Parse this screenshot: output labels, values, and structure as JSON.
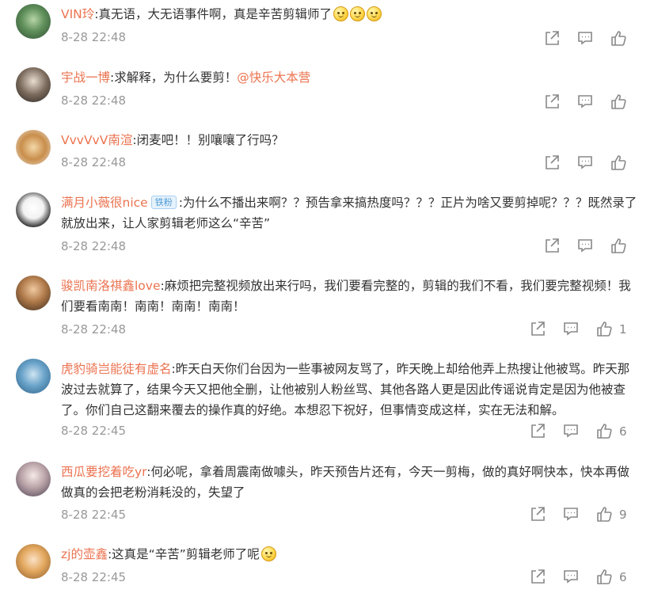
{
  "comments": [
    {
      "username": "VIN玲",
      "text": ":真无语，大无语事件啊，真是辛苦剪辑师了",
      "emoji": [
        "smile-emoji",
        "smile-emoji",
        "smile-emoji"
      ],
      "time": "8-28 22:48",
      "likes": ""
    },
    {
      "username": "宇战一博",
      "text": ":求解释，为什么要剪！",
      "mention": "@快乐大本营",
      "time": "8-28 22:48",
      "likes": ""
    },
    {
      "username": "VvvVvV南渲",
      "text": ":闭麦吧！！别嚷嚷了行吗？",
      "time": "8-28 22:48",
      "likes": ""
    },
    {
      "username": "满月小薇很nice",
      "badge": "铁粉",
      "text": ":为什么不播出来啊？？预告拿来搞热度吗？？？正片为啥又要剪掉呢？？？既然录了就放出来，让人家剪辑老师这么“辛苦”",
      "time": "8-28 22:48",
      "likes": ""
    },
    {
      "username": "骏凯南洛祺鑫love",
      "text": ":麻烦把完整视频放出来行吗，我们要看完整的，剪辑的我们不看，我们要完整视频！我们要看南南！南南！南南！南南！",
      "time": "8-28 22:48",
      "likes": "1"
    },
    {
      "username": "虎豹骑岂能徒有虚名",
      "text": ":昨天白天你们台因为一些事被网友骂了，昨天晚上却给他弄上热搜让他被骂。昨天那波过去就算了，结果今天又把他全删，让他被别人粉丝骂、其他各路人更是因此传谣说肯定是因为他被查了。你们自己这翻来覆去的操作真的好绝。本想忍下祝好，但事情变成这样，实在无法和解。",
      "time": "8-28 22:45",
      "likes": "6"
    },
    {
      "username": "西瓜要挖着吃yr",
      "text": ":何必呢，拿着周震南做噱头，昨天预告片还有，今天一剪梅，做的真好啊快本，快本再做做真的会把老粉消耗没的，失望了",
      "time": "8-28 22:45",
      "likes": "9"
    },
    {
      "username": "zj的壶鑫",
      "text": ":这真是“辛苦”剪辑老师了呢",
      "emoji": [
        "smile-emoji"
      ],
      "time": "8-28 22:45",
      "likes": "6"
    }
  ],
  "colors": {
    "username": "#eb7350",
    "text": "#333333",
    "time": "#999999",
    "icon": "#888888"
  }
}
